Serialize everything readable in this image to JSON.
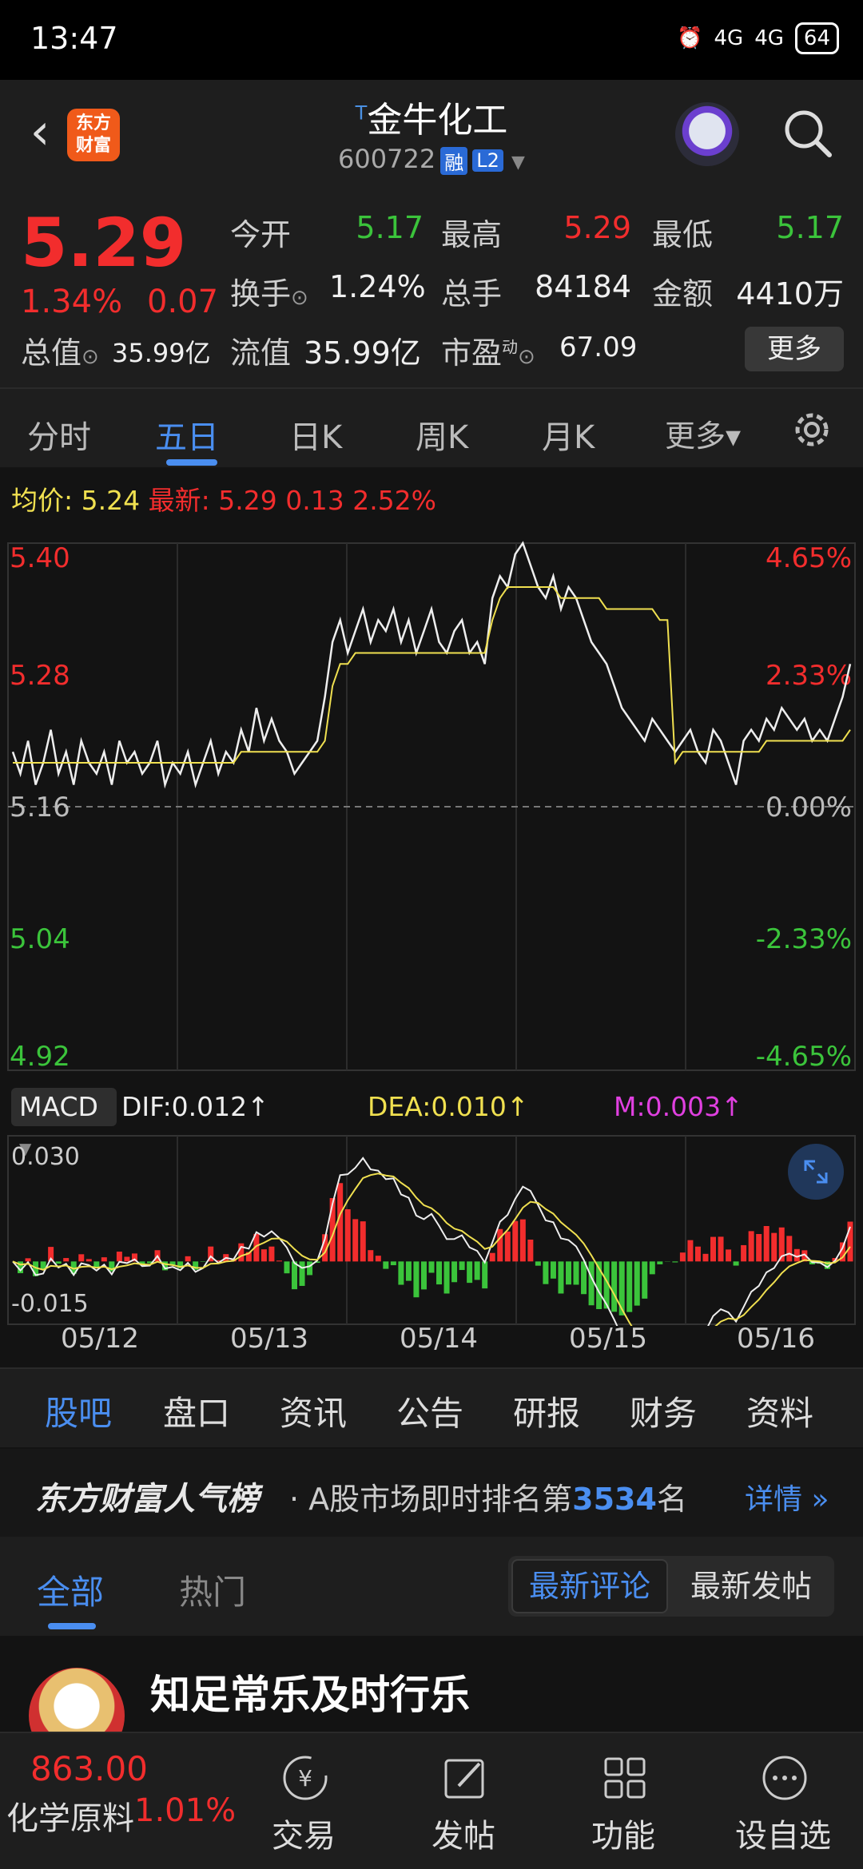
{
  "status_bar": {
    "time": "13:47",
    "network1": "4G",
    "network2": "4G",
    "battery": "64"
  },
  "header": {
    "title": "金牛化工",
    "code": "600722",
    "tag_margin": "融",
    "tag_level": "L2",
    "brand": "东方\n财富"
  },
  "quote": {
    "price": "5.29",
    "change_pct": "1.34%",
    "change": "0.07",
    "open_label": "今开",
    "open": "5.17",
    "high_label": "最高",
    "high": "5.29",
    "low_label": "最低",
    "low": "5.17",
    "turnover_label": "换手",
    "turnover": "1.24%",
    "volume_label": "总手",
    "volume": "84184",
    "amount_label": "金额",
    "amount": "4410万",
    "mktcap_label": "总值",
    "mktcap": "35.99亿",
    "float_label": "流值",
    "float_cap": "35.99亿",
    "pe_label": "市盈",
    "pe_sup": "动",
    "pe": "67.09",
    "more": "更多"
  },
  "period_tabs": [
    "分时",
    "五日",
    "日K",
    "周K",
    "月K",
    "更多▾"
  ],
  "chart_info": {
    "avg_label": "均价:",
    "avg": "5.24",
    "latest_label": "最新:",
    "latest": "5.29",
    "change": "0.13",
    "pct": "2.52%"
  },
  "chart_data": [
    {
      "type": "line",
      "y_ticks_left": [
        "5.40",
        "5.28",
        "5.16",
        "5.04",
        "4.92"
      ],
      "y_ticks_right": [
        "4.65%",
        "2.33%",
        "0.00%",
        "-2.33%",
        "-4.65%"
      ],
      "ylim": [
        4.92,
        5.4
      ],
      "prev_close": 5.16,
      "categories": [
        "05/12",
        "05/13",
        "05/14",
        "05/15",
        "05/16"
      ],
      "series": [
        {
          "values": [
            5.21,
            5.19,
            5.22,
            5.18,
            5.2,
            5.23,
            5.19,
            5.21,
            5.18,
            5.22,
            5.2,
            5.19,
            5.21,
            5.18,
            5.22,
            5.2,
            5.21,
            5.19,
            5.2,
            5.22,
            5.18,
            5.2,
            5.19,
            5.21,
            5.18,
            5.2,
            5.22,
            5.19,
            5.21,
            5.2,
            5.23,
            5.21,
            5.25,
            5.22,
            5.24,
            5.22,
            5.21,
            5.19,
            5.2,
            5.21,
            5.22,
            5.26,
            5.31,
            5.33,
            5.3,
            5.32,
            5.34,
            5.31,
            5.33,
            5.32,
            5.34,
            5.31,
            5.33,
            5.3,
            5.32,
            5.34,
            5.31,
            5.3,
            5.32,
            5.33,
            5.3,
            5.31,
            5.29,
            5.35,
            5.37,
            5.36,
            5.39,
            5.4,
            5.38,
            5.36,
            5.35,
            5.37,
            5.34,
            5.36,
            5.35,
            5.33,
            5.31,
            5.3,
            5.29,
            5.27,
            5.25,
            5.24,
            5.23,
            5.22,
            5.24,
            5.23,
            5.22,
            5.21,
            5.22,
            5.23,
            5.21,
            5.2,
            5.23,
            5.22,
            5.2,
            5.18,
            5.22,
            5.23,
            5.22,
            5.24,
            5.23,
            5.25,
            5.24,
            5.23,
            5.24,
            5.22,
            5.23,
            5.22,
            5.24,
            5.26,
            5.29
          ]
        },
        {
          "values": [
            5.2,
            5.2,
            5.2,
            5.2,
            5.2,
            5.2,
            5.2,
            5.2,
            5.2,
            5.2,
            5.2,
            5.2,
            5.2,
            5.2,
            5.2,
            5.2,
            5.2,
            5.2,
            5.2,
            5.2,
            5.2,
            5.2,
            5.2,
            5.2,
            5.2,
            5.2,
            5.2,
            5.2,
            5.2,
            5.2,
            5.21,
            5.21,
            5.21,
            5.21,
            5.21,
            5.21,
            5.21,
            5.21,
            5.21,
            5.21,
            5.21,
            5.22,
            5.27,
            5.29,
            5.29,
            5.3,
            5.3,
            5.3,
            5.3,
            5.3,
            5.3,
            5.3,
            5.3,
            5.3,
            5.3,
            5.3,
            5.3,
            5.3,
            5.3,
            5.3,
            5.3,
            5.3,
            5.3,
            5.33,
            5.35,
            5.36,
            5.36,
            5.36,
            5.36,
            5.36,
            5.36,
            5.36,
            5.35,
            5.35,
            5.35,
            5.35,
            5.35,
            5.35,
            5.34,
            5.34,
            5.34,
            5.34,
            5.34,
            5.34,
            5.34,
            5.33,
            5.33,
            5.2,
            5.21,
            5.21,
            5.21,
            5.21,
            5.21,
            5.21,
            5.21,
            5.21,
            5.21,
            5.21,
            5.21,
            5.22,
            5.22,
            5.22,
            5.22,
            5.22,
            5.22,
            5.22,
            5.22,
            5.22,
            5.22,
            5.22,
            5.23
          ]
        }
      ]
    },
    {
      "type": "bar",
      "ylim": [
        -0.015,
        0.03
      ],
      "y_ticks": [
        "0.030",
        "-0.015"
      ]
    }
  ],
  "macd": {
    "label": "MACD",
    "dif": "DIF:0.012↑",
    "dea": "DEA:0.010↑",
    "m": "M:0.003↑"
  },
  "info_tabs": [
    "股吧",
    "盘口",
    "资讯",
    "公告",
    "研报",
    "财务",
    "资料"
  ],
  "rank": {
    "brand": "东方财富人气榜",
    "text_before": "· A股市场即时排名第",
    "num": "3534",
    "text_after": "名",
    "detail": "详情 »"
  },
  "sub_tabs": {
    "all": "全部",
    "hot": "热门",
    "latest_comment": "最新评论",
    "latest_post": "最新发帖"
  },
  "post": {
    "user": "知足常乐及时行乐"
  },
  "bottom_nav": {
    "index_value": "863.00",
    "index_name": "化学原料",
    "index_pct": "1.01%",
    "items": [
      "交易",
      "发帖",
      "功能",
      "设自选"
    ]
  },
  "colors": {
    "up": "#f22d2d",
    "down": "#3bc43b",
    "accent": "#4a8ef0",
    "avg_line": "#f0e050"
  }
}
